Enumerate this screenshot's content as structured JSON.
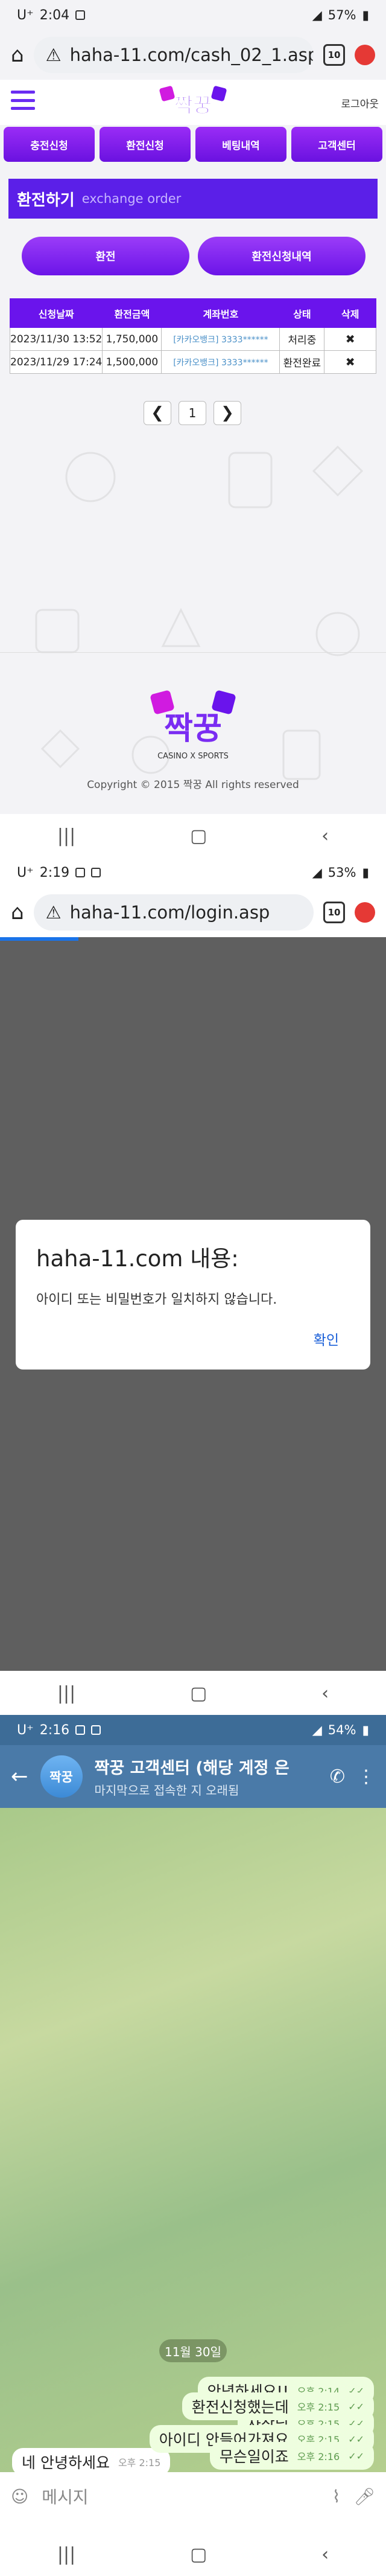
{
  "screen1": {
    "status": {
      "carrier": "U⁺",
      "time": "2:04",
      "battery": "57%"
    },
    "url": "haha-11.com/cash_02_1.asp",
    "tab_count": "10",
    "site": {
      "logo_text": "짝꿍",
      "logout": "로그아웃",
      "menu": [
        "충전신청",
        "환전신청",
        "베팅내역",
        "고객센터"
      ],
      "exchange_title": "환전하기",
      "exchange_subtitle": "exchange order",
      "buttons": [
        "환전",
        "환전신청내역"
      ],
      "table": {
        "headers": [
          "신청날짜",
          "환전금액",
          "계좌번호",
          "상태",
          "삭제"
        ],
        "rows": [
          [
            "2023/11/30 13:52",
            "1,750,000",
            "[카카오뱅크] 3333******",
            "처리중",
            "✖"
          ],
          [
            "2023/11/29 17:24",
            "1,500,000",
            "[카카오뱅크] 3333******",
            "환전완료",
            "✖"
          ]
        ]
      },
      "pager": {
        "prev": "❮",
        "page": "1",
        "next": "❯"
      },
      "footer_logo_text": "짝꿍",
      "footer_tagline": "CASINO X SPORTS",
      "copyright": "Copyright © 2015 짝꿍 All rights reserved"
    }
  },
  "screen2": {
    "status": {
      "carrier": "U⁺",
      "time": "2:19",
      "battery": "53%"
    },
    "url": "haha-11.com/login.asp",
    "tab_count": "10",
    "dialog": {
      "title": "haha-11.com 내용:",
      "message": "아이디 또는 비밀번호가 일치하지 않습니다.",
      "ok": "확인"
    }
  },
  "screen3": {
    "status": {
      "carrier": "U⁺",
      "time": "2:16",
      "battery": "54%"
    },
    "chat": {
      "avatar_text": "짝꿍",
      "title": "짝꿍 고객센터 (해당 계정 은",
      "subtitle": "마지막으로 접속한 지 오래됨",
      "date": "11월 30일",
      "messages": [
        {
          "dir": "out",
          "text": "안녕하세요!!",
          "time": "오후 2:14",
          "check": "✓✓"
        },
        {
          "dir": "out",
          "text": "사장님",
          "time": "오후 2:15",
          "check": "✓✓"
        },
        {
          "dir": "in",
          "text": "네 안녕하세요",
          "time": "오후 2:15"
        },
        {
          "dir": "out",
          "text": "환전신청했는데",
          "time": "오후 2:15",
          "check": "✓✓"
        },
        {
          "dir": "out",
          "text": "아이디 안들어가져요",
          "time": "오후 2:15",
          "check": "✓✓"
        },
        {
          "dir": "out",
          "text": "무슨일이죠",
          "time": "오후 2:16",
          "check": "✓✓"
        }
      ],
      "input_placeholder": "메시지"
    }
  },
  "colors": {
    "purple": "#6a14ec",
    "telegram_header": "#4a7aa8",
    "link_blue": "#1a5fd8"
  }
}
